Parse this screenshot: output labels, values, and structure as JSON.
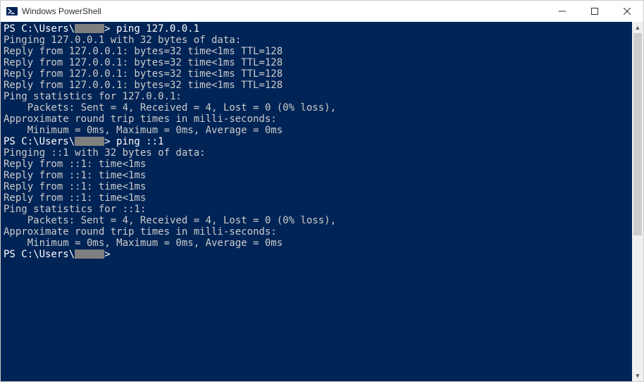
{
  "window": {
    "title": "Windows PowerShell"
  },
  "terminal": {
    "promptPrefix": "PS C:\\Users\\",
    "promptSuffix": ">",
    "cmd1": "ping 127.0.0.1",
    "cmd2": "ping ::1",
    "lines1": [
      "Pinging 127.0.0.1 with 32 bytes of data:",
      "Reply from 127.0.0.1: bytes=32 time<1ms TTL=128",
      "Reply from 127.0.0.1: bytes=32 time<1ms TTL=128",
      "Reply from 127.0.0.1: bytes=32 time<1ms TTL=128",
      "Reply from 127.0.0.1: bytes=32 time<1ms TTL=128",
      "",
      "Ping statistics for 127.0.0.1:",
      "    Packets: Sent = 4, Received = 4, Lost = 0 (0% loss),",
      "Approximate round trip times in milli-seconds:",
      "    Minimum = 0ms, Maximum = 0ms, Average = 0ms"
    ],
    "lines2": [
      "Pinging ::1 with 32 bytes of data:",
      "Reply from ::1: time<1ms",
      "Reply from ::1: time<1ms",
      "Reply from ::1: time<1ms",
      "Reply from ::1: time<1ms",
      "",
      "Ping statistics for ::1:",
      "    Packets: Sent = 4, Received = 4, Lost = 0 (0% loss),",
      "Approximate round trip times in milli-seconds:",
      "    Minimum = 0ms, Maximum = 0ms, Average = 0ms"
    ]
  }
}
